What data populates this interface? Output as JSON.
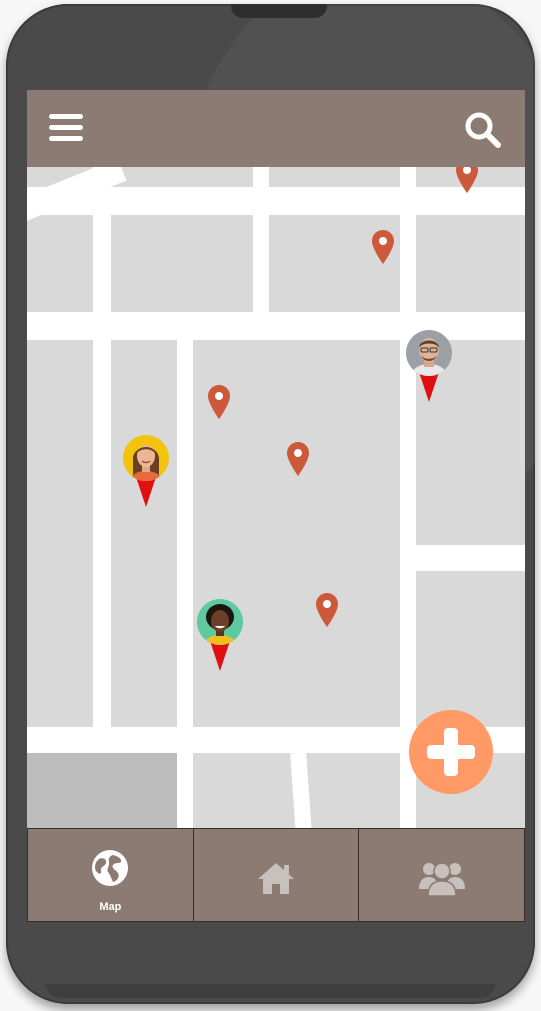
{
  "header": {
    "menu_icon": "hamburger-menu-icon",
    "search_icon": "search-icon"
  },
  "map": {
    "location_pins": [
      {
        "icon": "map-pin-icon",
        "color": "#cc5a3a"
      },
      {
        "icon": "map-pin-icon",
        "color": "#cc5a3a"
      },
      {
        "icon": "map-pin-icon",
        "color": "#cc5a3a"
      },
      {
        "icon": "map-pin-icon",
        "color": "#cc5a3a"
      },
      {
        "icon": "map-pin-icon",
        "color": "#cc5a3a"
      }
    ],
    "user_markers": [
      {
        "icon": "user-avatar-marker",
        "avatar_bg": "#9aa0a6",
        "tail_color": "#e01010"
      },
      {
        "icon": "user-avatar-marker",
        "avatar_bg": "#f2c40f",
        "tail_color": "#e01010"
      },
      {
        "icon": "user-avatar-marker",
        "avatar_bg": "#5ec8a0",
        "tail_color": "#e01010"
      }
    ]
  },
  "fab": {
    "icon": "plus-icon",
    "color": "#ff9a66"
  },
  "bottom_nav": {
    "items": [
      {
        "icon": "globe-icon",
        "label": "Map"
      },
      {
        "icon": "home-icon",
        "label": ""
      },
      {
        "icon": "users-group-icon",
        "label": ""
      }
    ]
  },
  "colors": {
    "header_bg": "#8c7b73",
    "map_bg": "#d9d9d9",
    "road": "#ffffff",
    "phone_body": "#4a4a4a"
  }
}
